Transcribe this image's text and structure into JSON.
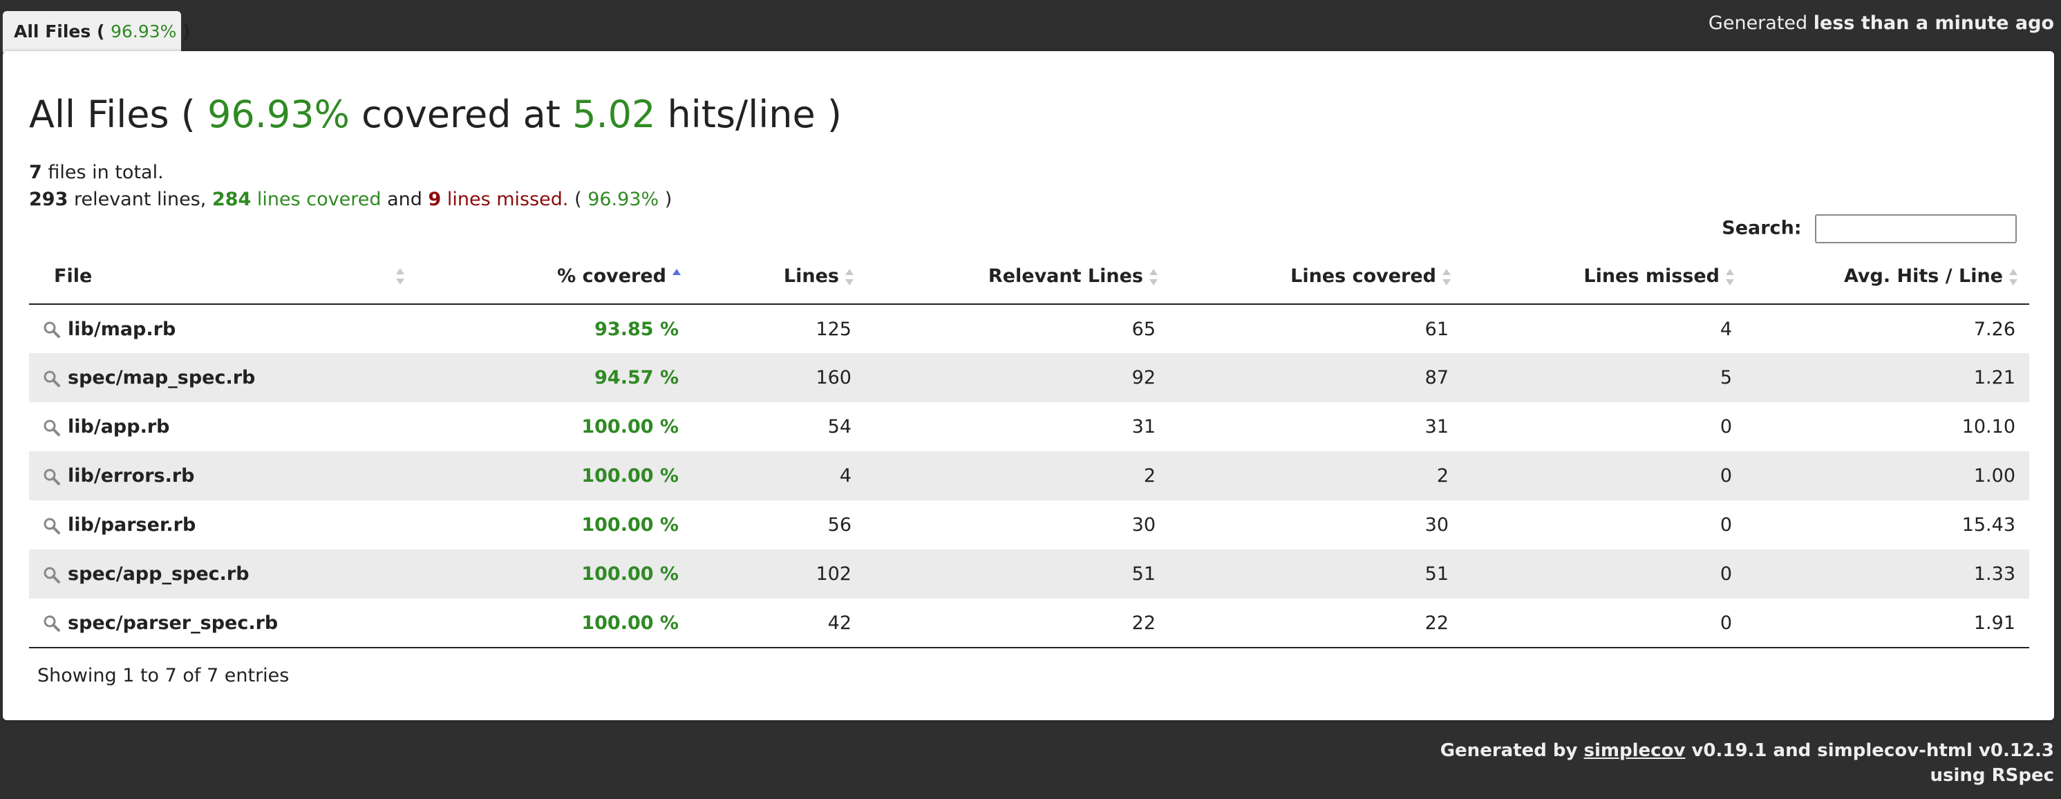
{
  "tab": {
    "label_prefix": "All Files ( ",
    "percent": "96.93%",
    "label_suffix": " )"
  },
  "header": {
    "generated_prefix": "Generated ",
    "generated_time": "less than a minute ago"
  },
  "title": {
    "prefix": "All Files ( ",
    "percent": "96.93%",
    "middle": " covered at ",
    "hits": "5.02",
    "suffix": " hits/line )"
  },
  "summary": {
    "files_count": "7",
    "files_text": " files in total.",
    "relevant": "293",
    "relevant_text": " relevant lines, ",
    "covered": "284",
    "covered_text": " lines covered",
    "and_text": " and ",
    "missed": "9",
    "missed_text": " lines missed.",
    "percent_prefix": " ( ",
    "percent": "96.93%",
    "percent_suffix": " )"
  },
  "search": {
    "label": "Search:",
    "value": ""
  },
  "columns": [
    "File",
    "% covered",
    "Lines",
    "Relevant Lines",
    "Lines covered",
    "Lines missed",
    "Avg. Hits / Line"
  ],
  "rows": [
    {
      "file": "lib/map.rb",
      "covered": "93.85 %",
      "lines": "125",
      "relevant": "65",
      "lines_covered": "61",
      "missed": "4",
      "avg": "7.26"
    },
    {
      "file": "spec/map_spec.rb",
      "covered": "94.57 %",
      "lines": "160",
      "relevant": "92",
      "lines_covered": "87",
      "missed": "5",
      "avg": "1.21"
    },
    {
      "file": "lib/app.rb",
      "covered": "100.00 %",
      "lines": "54",
      "relevant": "31",
      "lines_covered": "31",
      "missed": "0",
      "avg": "10.10"
    },
    {
      "file": "lib/errors.rb",
      "covered": "100.00 %",
      "lines": "4",
      "relevant": "2",
      "lines_covered": "2",
      "missed": "0",
      "avg": "1.00"
    },
    {
      "file": "lib/parser.rb",
      "covered": "100.00 %",
      "lines": "56",
      "relevant": "30",
      "lines_covered": "30",
      "missed": "0",
      "avg": "15.43"
    },
    {
      "file": "spec/app_spec.rb",
      "covered": "100.00 %",
      "lines": "102",
      "relevant": "51",
      "lines_covered": "51",
      "missed": "0",
      "avg": "1.33"
    },
    {
      "file": "spec/parser_spec.rb",
      "covered": "100.00 %",
      "lines": "42",
      "relevant": "22",
      "lines_covered": "22",
      "missed": "0",
      "avg": "1.91"
    }
  ],
  "entries_info": "Showing 1 to 7 of 7 entries",
  "footer": {
    "prefix": "Generated by ",
    "link": "simplecov",
    "middle": " v0.19.1 and simplecov-html v0.12.3",
    "line2": "using RSpec"
  },
  "icons": {
    "file_row": "magnifier-icon",
    "sort": "sort-arrows-icon"
  },
  "colors": {
    "covered_green": "#2f8a23",
    "missed_red": "#8b0b0b",
    "background": "#2f2f2f",
    "row_alt": "#ebebeb"
  }
}
